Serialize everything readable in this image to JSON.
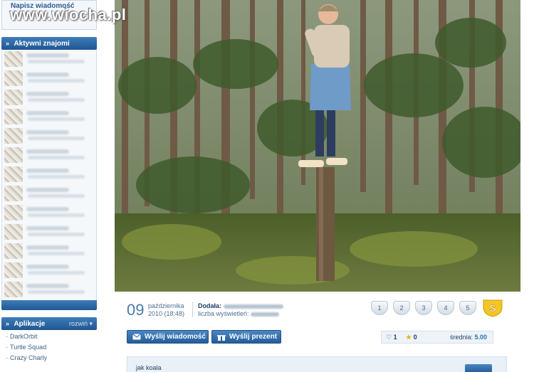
{
  "sidebar": {
    "top_link": "Napisz wiadomość",
    "friends_header": "Aktywni znajomi",
    "apps_header": "Aplikacje",
    "apps_toggle": "rozwiń",
    "apps": [
      "DarkOrbit",
      "Turtle Squad",
      "Crazy Charly"
    ]
  },
  "watermark": "www.wiocha.pl",
  "photo": {
    "description_icon": "forest-photo"
  },
  "post": {
    "day": "09",
    "month": "października",
    "year_time": "2010 (18:48)",
    "added_label": "Dodała:",
    "views_label": "liczba wyświetleń:",
    "ratings": [
      "1",
      "2",
      "3",
      "4",
      "5"
    ]
  },
  "actions": {
    "send_message": "Wyślij wiadomość",
    "send_gift": "Wyślij prezent"
  },
  "stats": {
    "likes": "1",
    "favorites": "0",
    "average_label": "średnia:",
    "average_value": "5.00"
  },
  "comment": {
    "text": "jak koala"
  },
  "colors": {
    "accent": "#245d99",
    "header_blue": "#1f5793",
    "text": "#1e3f66"
  }
}
